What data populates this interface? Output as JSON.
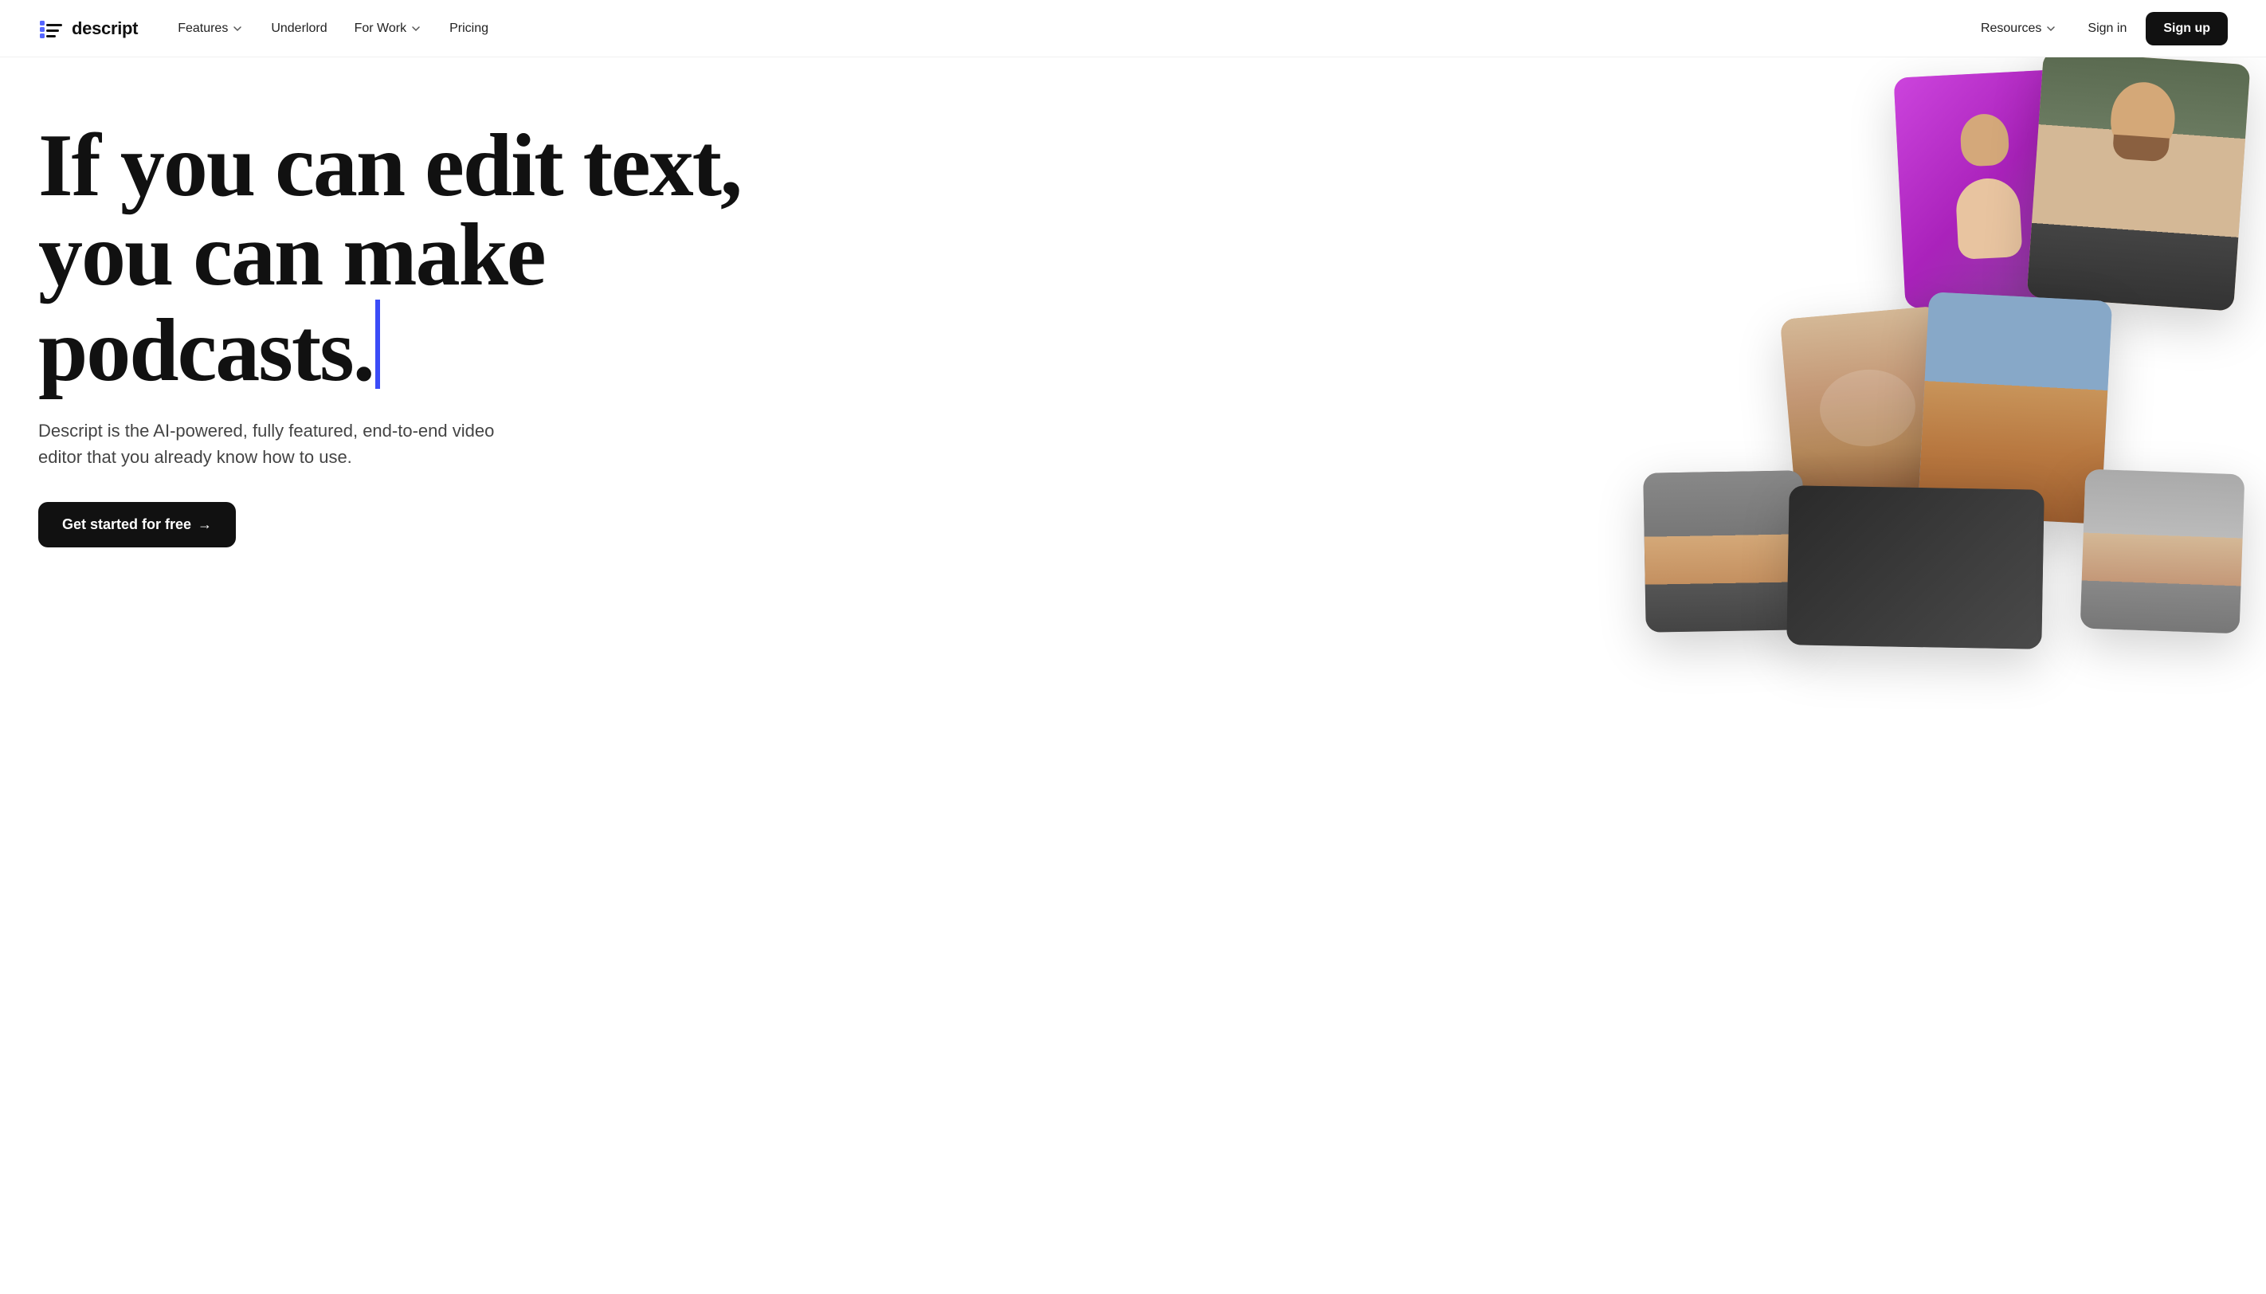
{
  "logo": {
    "text": "descript",
    "icon_alt": "descript-logo"
  },
  "nav": {
    "links": [
      {
        "id": "features",
        "label": "Features",
        "has_dropdown": true
      },
      {
        "id": "underlord",
        "label": "Underlord",
        "has_dropdown": false
      },
      {
        "id": "for-work",
        "label": "For Work",
        "has_dropdown": true
      },
      {
        "id": "pricing",
        "label": "Pricing",
        "has_dropdown": false
      }
    ],
    "right": [
      {
        "id": "resources",
        "label": "Resources",
        "has_dropdown": true
      },
      {
        "id": "signin",
        "label": "Sign in",
        "has_dropdown": false
      },
      {
        "id": "signup",
        "label": "Sign up",
        "has_dropdown": false
      }
    ]
  },
  "hero": {
    "headline_line1": "If you can edit text,",
    "headline_line2": "you can make podcasts.",
    "subtext": "Descript is the AI-powered, fully featured, end-to-end video editor that you already know how to use.",
    "cta_label": "Get started for free",
    "cta_arrow": "→"
  },
  "colors": {
    "cursor": "#3b4cf7",
    "cta_bg": "#111111",
    "logo_accent": "#5566ff"
  }
}
